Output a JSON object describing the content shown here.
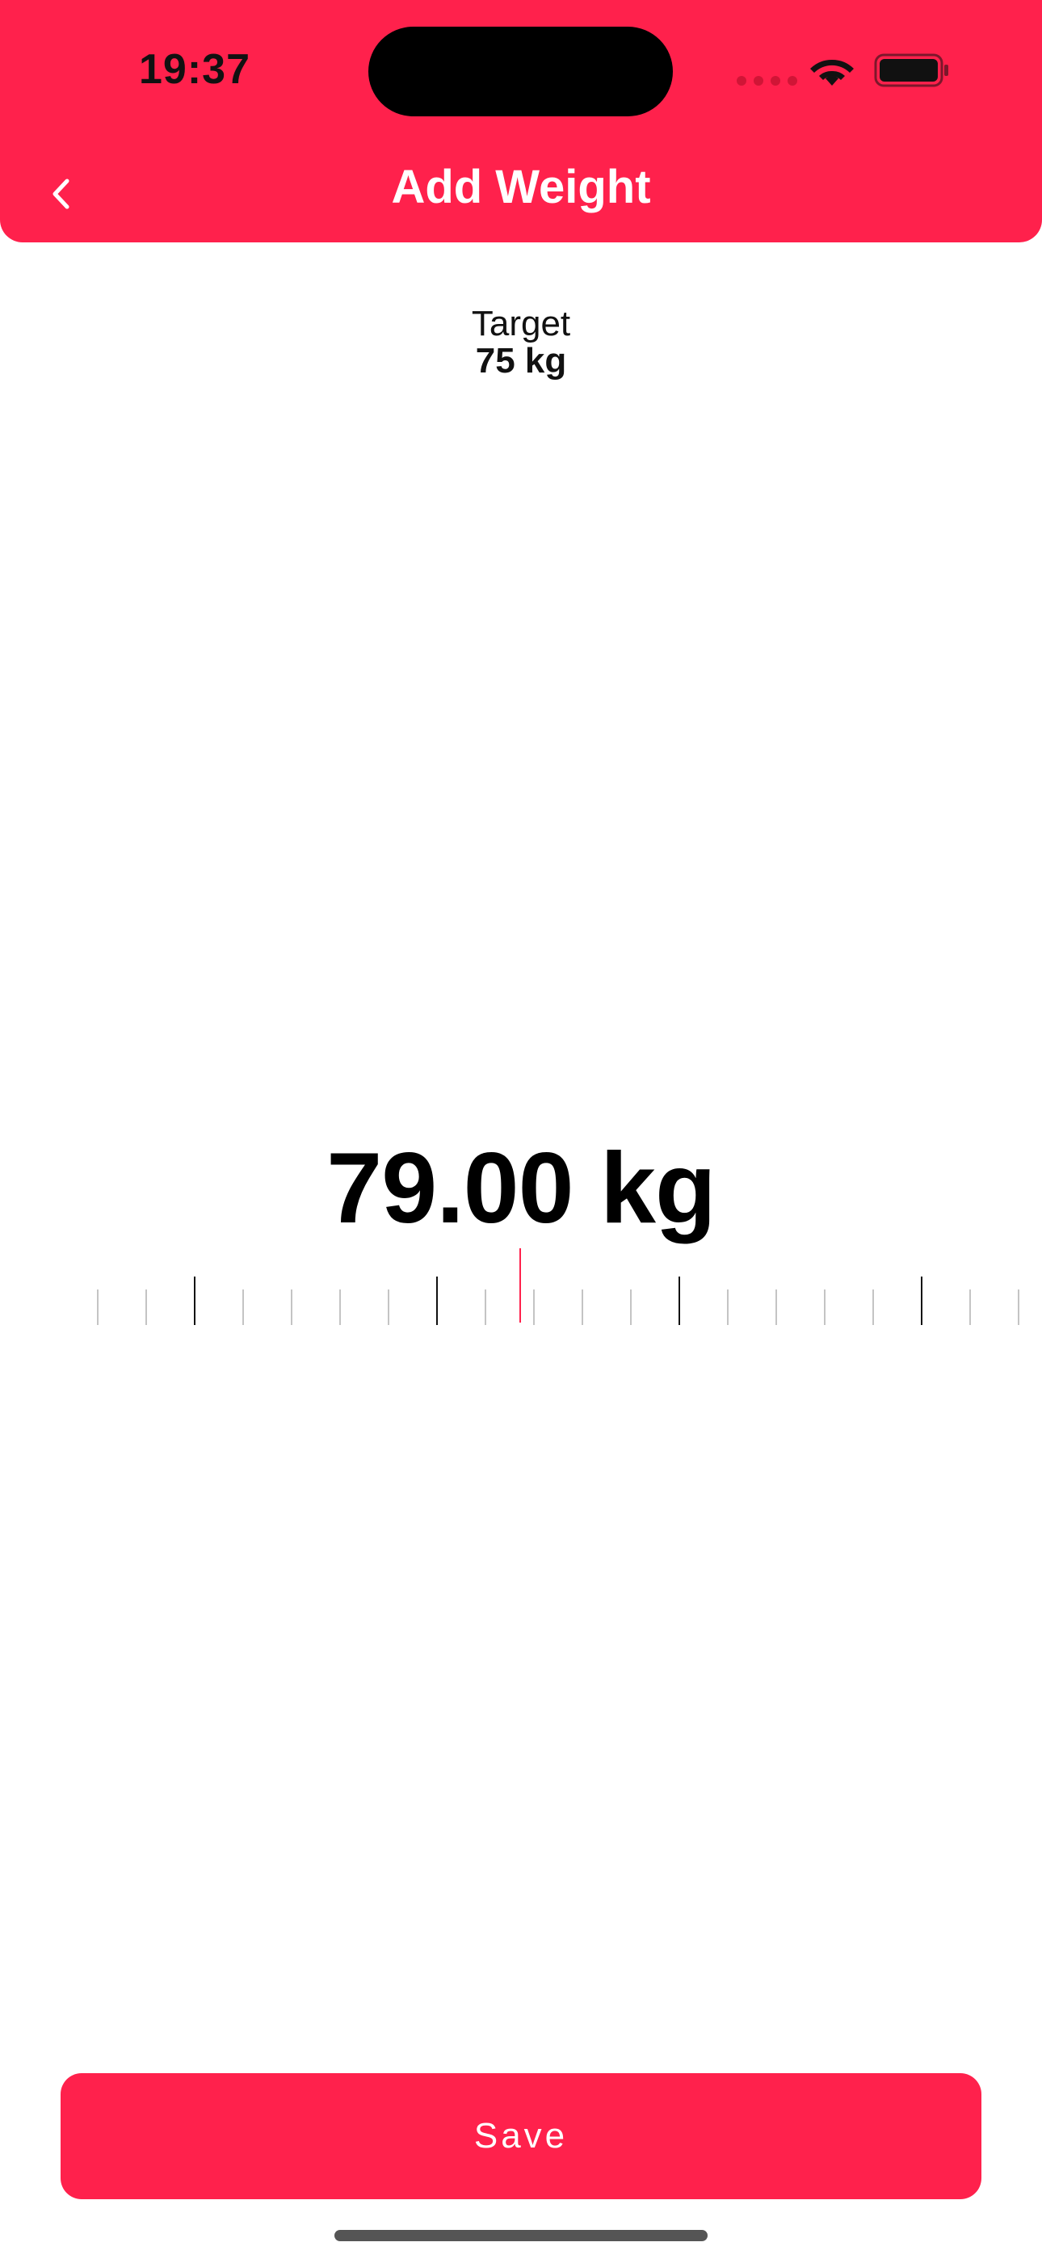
{
  "status_bar": {
    "time": "19:37",
    "icons": [
      "cellular-signal-icon",
      "wifi-icon",
      "battery-icon"
    ]
  },
  "header": {
    "title": "Add Weight",
    "back_icon": "chevron-left-icon"
  },
  "target": {
    "label": "Target",
    "value": "75 kg"
  },
  "weight": {
    "value": "79.00 kg"
  },
  "ruler": {
    "selected_value": 79.0,
    "step": 0.1,
    "major_every": 5
  },
  "save_button": {
    "label": "Save"
  },
  "colors": {
    "accent": "#ff214c",
    "text": "#111111",
    "tick_minor": "#c4c4c4",
    "tick_major": "#111111"
  }
}
